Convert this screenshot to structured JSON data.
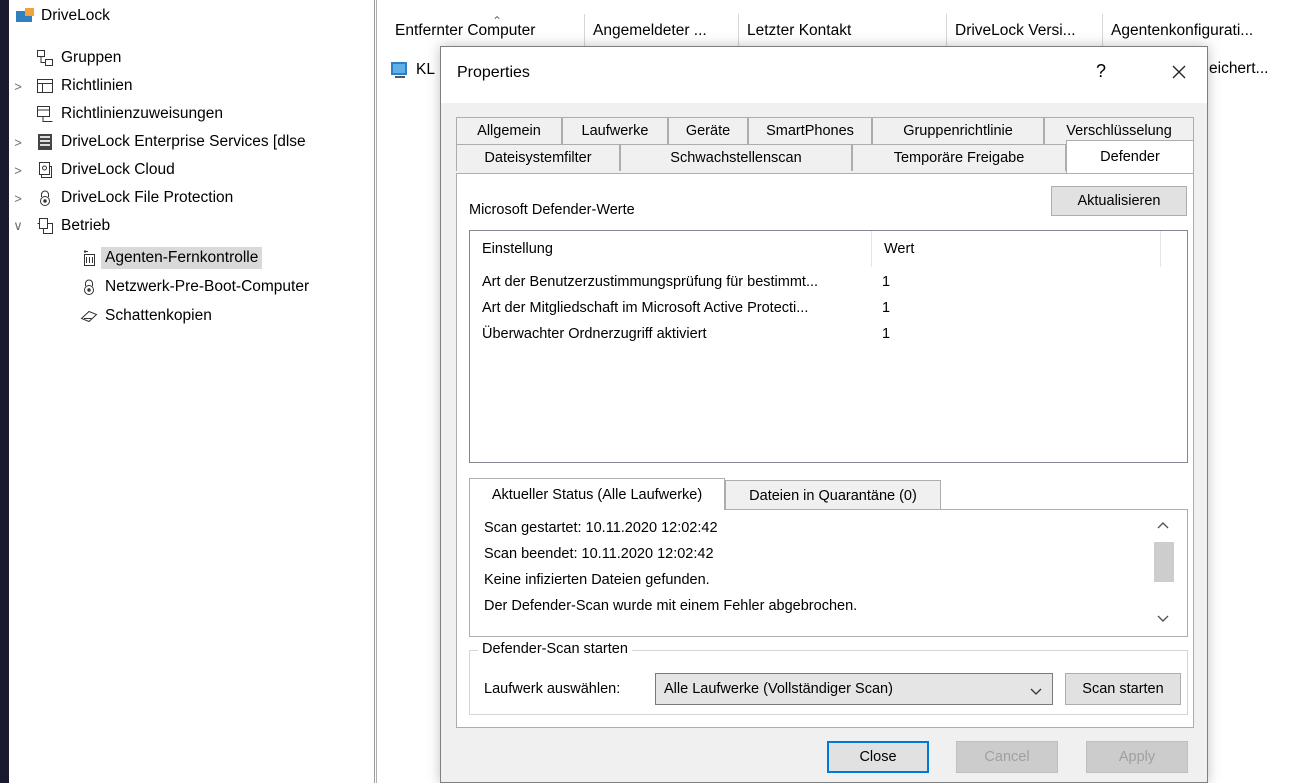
{
  "tree": {
    "root": "DriveLock",
    "items": [
      {
        "label": "Gruppen",
        "icon": "groups-icon",
        "chevron": ""
      },
      {
        "label": "Richtlinien",
        "icon": "policy-icon",
        "chevron": ">"
      },
      {
        "label": "Richtlinienzuweisungen",
        "icon": "policy-assignment-icon",
        "chevron": ""
      },
      {
        "label": "DriveLock Enterprise Services [dlse",
        "icon": "server-icon",
        "chevron": ">"
      },
      {
        "label": "DriveLock Cloud",
        "icon": "cloud-icon",
        "chevron": ">"
      },
      {
        "label": "DriveLock File Protection",
        "icon": "lock-icon",
        "chevron": ">"
      },
      {
        "label": "Betrieb",
        "icon": "operations-icon",
        "chevron": "v"
      },
      {
        "label": "Agenten-Fernkontrolle",
        "icon": "agent-remote-icon",
        "chevron": ""
      },
      {
        "label": "Netzwerk-Pre-Boot-Computer",
        "icon": "lock-icon",
        "chevron": ""
      },
      {
        "label": "Schattenkopien",
        "icon": "shadow-copy-icon",
        "chevron": ""
      }
    ]
  },
  "list": {
    "columns": [
      "Entfernter Computer",
      "Angemeldeter ...",
      "Letzter Kontakt",
      "DriveLock Versi...",
      "Agentenkonfigurati..."
    ],
    "row_fragment_left": "KL",
    "row_fragment_right": "eichert..."
  },
  "dialog": {
    "title": "Properties",
    "help": "?",
    "tabs_row1": [
      "Allgemein",
      "Laufwerke",
      "Geräte",
      "SmartPhones",
      "Gruppenrichtlinie",
      "Verschlüsselung"
    ],
    "tabs_row2": [
      "Dateisystemfilter",
      "Schwachstellenscan",
      "Temporäre Freigabe",
      "Defender"
    ],
    "active_tab": "Defender",
    "section_label": "Microsoft Defender-Werte",
    "refresh_button": "Aktualisieren",
    "table": {
      "headers": [
        "Einstellung",
        "Wert"
      ],
      "rows": [
        {
          "setting": "Art der Benutzerzustimmungsprüfung für bestimmt...",
          "value": "1"
        },
        {
          "setting": "Art der Mitgliedschaft im Microsoft Active Protecti...",
          "value": "1"
        },
        {
          "setting": "Überwachter Ordnerzugriff aktiviert",
          "value": "1"
        }
      ]
    },
    "subtabs": [
      "Aktueller Status (Alle Laufwerke)",
      "Dateien in Quarantäne (0)"
    ],
    "status_lines": [
      "Scan gestartet: 10.11.2020 12:02:42",
      "Scan beendet: 10.11.2020 12:02:42",
      "Keine infizierten Dateien gefunden.",
      "Der Defender-Scan wurde mit einem Fehler abgebrochen."
    ],
    "scan_group": {
      "legend": "Defender-Scan starten",
      "drive_label": "Laufwerk auswählen:",
      "drive_value": "Alle Laufwerke (Vollständiger Scan)",
      "start_button": "Scan starten"
    },
    "buttons": {
      "close": "Close",
      "cancel": "Cancel",
      "apply": "Apply"
    }
  }
}
